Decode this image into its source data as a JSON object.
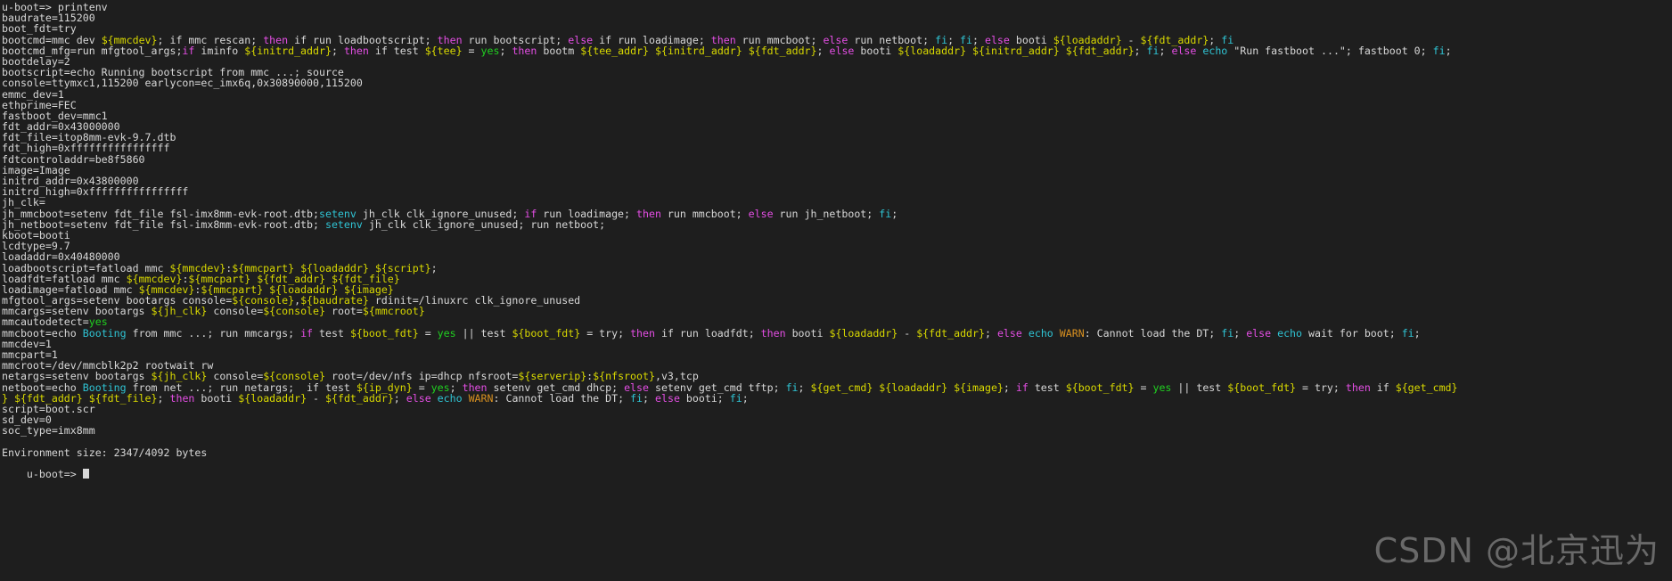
{
  "terminal": {
    "prompt": "u-boot=> ",
    "command": "printenv",
    "background_color": "#1e1e1e",
    "foreground_color": "#d8d8d8",
    "colors": {
      "variable": "#d8d800",
      "keyword": "#e44ee4",
      "builtin": "#2fc4d4",
      "value_yes": "#20d020",
      "warning": "#d89020"
    },
    "footer_status": "Environment size: 2347/4092 bytes",
    "final_prompt": "u-boot=> ",
    "watermark": "CSDN @北京迅为"
  },
  "lines": [
    {
      "id": 0,
      "segments": [
        {
          "t": "u-boot=> printenv",
          "c": "def"
        }
      ]
    },
    {
      "id": 1,
      "segments": [
        {
          "t": "baudrate=115200",
          "c": "def"
        }
      ]
    },
    {
      "id": 2,
      "segments": [
        {
          "t": "boot_fdt=try",
          "c": "def"
        }
      ]
    },
    {
      "id": 3,
      "segments": [
        {
          "t": "bootcmd=mmc dev ",
          "c": "def"
        },
        {
          "t": "${mmcdev}",
          "c": "var"
        },
        {
          "t": "; if mmc rescan; ",
          "c": "def"
        },
        {
          "t": "then",
          "c": "kw"
        },
        {
          "t": " if run loadbootscript; ",
          "c": "def"
        },
        {
          "t": "then",
          "c": "kw"
        },
        {
          "t": " run bootscript; ",
          "c": "def"
        },
        {
          "t": "else",
          "c": "kw"
        },
        {
          "t": " if run loadimage; ",
          "c": "def"
        },
        {
          "t": "then",
          "c": "kw"
        },
        {
          "t": " run mmcboot; ",
          "c": "def"
        },
        {
          "t": "else",
          "c": "kw"
        },
        {
          "t": " run netboot; ",
          "c": "def"
        },
        {
          "t": "fi",
          "c": "fi"
        },
        {
          "t": "; ",
          "c": "def"
        },
        {
          "t": "fi",
          "c": "fi"
        },
        {
          "t": "; ",
          "c": "def"
        },
        {
          "t": "else",
          "c": "kw"
        },
        {
          "t": " booti ",
          "c": "def"
        },
        {
          "t": "${loadaddr}",
          "c": "var"
        },
        {
          "t": " - ",
          "c": "def"
        },
        {
          "t": "${fdt_addr}",
          "c": "var"
        },
        {
          "t": "; ",
          "c": "def"
        },
        {
          "t": "fi",
          "c": "fi"
        }
      ]
    },
    {
      "id": 4,
      "segments": [
        {
          "t": "bootcmd_mfg=run mfgtool_args;",
          "c": "def"
        },
        {
          "t": "if",
          "c": "kw"
        },
        {
          "t": " iminfo ",
          "c": "def"
        },
        {
          "t": "${initrd_addr}",
          "c": "var"
        },
        {
          "t": "; ",
          "c": "def"
        },
        {
          "t": "then",
          "c": "kw"
        },
        {
          "t": " if test ",
          "c": "def"
        },
        {
          "t": "${tee}",
          "c": "var"
        },
        {
          "t": " = ",
          "c": "def"
        },
        {
          "t": "yes",
          "c": "yes"
        },
        {
          "t": "; ",
          "c": "def"
        },
        {
          "t": "then",
          "c": "kw"
        },
        {
          "t": " bootm ",
          "c": "def"
        },
        {
          "t": "${tee_addr}",
          "c": "var"
        },
        {
          "t": " ",
          "c": "def"
        },
        {
          "t": "${initrd_addr}",
          "c": "var"
        },
        {
          "t": " ",
          "c": "def"
        },
        {
          "t": "${fdt_addr}",
          "c": "var"
        },
        {
          "t": "; ",
          "c": "def"
        },
        {
          "t": "else",
          "c": "kw"
        },
        {
          "t": " booti ",
          "c": "def"
        },
        {
          "t": "${loadaddr}",
          "c": "var"
        },
        {
          "t": " ",
          "c": "def"
        },
        {
          "t": "${initrd_addr}",
          "c": "var"
        },
        {
          "t": " ",
          "c": "def"
        },
        {
          "t": "${fdt_addr}",
          "c": "var"
        },
        {
          "t": "; ",
          "c": "def"
        },
        {
          "t": "fi",
          "c": "fi"
        },
        {
          "t": "; ",
          "c": "def"
        },
        {
          "t": "else",
          "c": "kw"
        },
        {
          "t": " ",
          "c": "def"
        },
        {
          "t": "echo",
          "c": "fi"
        },
        {
          "t": " \"Run fastboot ...\"; fastboot 0; ",
          "c": "def"
        },
        {
          "t": "fi",
          "c": "fi"
        },
        {
          "t": ";",
          "c": "def"
        }
      ]
    },
    {
      "id": 5,
      "segments": [
        {
          "t": "bootdelay=2",
          "c": "def"
        }
      ]
    },
    {
      "id": 6,
      "segments": [
        {
          "t": "bootscript=echo Running bootscript from mmc ...; source",
          "c": "def"
        }
      ]
    },
    {
      "id": 7,
      "segments": [
        {
          "t": "console=ttymxc1,115200 earlycon=ec_imx6q,0x30890000,115200",
          "c": "def"
        }
      ]
    },
    {
      "id": 8,
      "segments": [
        {
          "t": "emmc_dev=1",
          "c": "def"
        }
      ]
    },
    {
      "id": 9,
      "segments": [
        {
          "t": "ethprime=FEC",
          "c": "def"
        }
      ]
    },
    {
      "id": 10,
      "segments": [
        {
          "t": "fastboot_dev=mmc1",
          "c": "def"
        }
      ]
    },
    {
      "id": 11,
      "segments": [
        {
          "t": "fdt_addr=0x43000000",
          "c": "def"
        }
      ]
    },
    {
      "id": 12,
      "segments": [
        {
          "t": "fdt_file=itop8mm-evk-9.7.dtb",
          "c": "def"
        }
      ]
    },
    {
      "id": 13,
      "segments": [
        {
          "t": "fdt_high=0xffffffffffffffff",
          "c": "def"
        }
      ]
    },
    {
      "id": 14,
      "segments": [
        {
          "t": "fdtcontroladdr=be8f5860",
          "c": "def"
        }
      ]
    },
    {
      "id": 15,
      "segments": [
        {
          "t": "image=Image",
          "c": "def"
        }
      ]
    },
    {
      "id": 16,
      "segments": [
        {
          "t": "initrd_addr=0x43800000",
          "c": "def"
        }
      ]
    },
    {
      "id": 17,
      "segments": [
        {
          "t": "initrd_high=0xffffffffffffffff",
          "c": "def"
        }
      ]
    },
    {
      "id": 18,
      "segments": [
        {
          "t": "jh_clk=",
          "c": "def"
        }
      ]
    },
    {
      "id": 19,
      "segments": [
        {
          "t": "jh_mmcboot=setenv fdt_file fsl-imx8mm-evk-root.dtb;",
          "c": "def"
        },
        {
          "t": "setenv",
          "c": "fi"
        },
        {
          "t": " jh_clk clk_ignore_unused; ",
          "c": "def"
        },
        {
          "t": "if",
          "c": "kw"
        },
        {
          "t": " run loadimage; ",
          "c": "def"
        },
        {
          "t": "then",
          "c": "kw"
        },
        {
          "t": " run mmcboot; ",
          "c": "def"
        },
        {
          "t": "else",
          "c": "kw"
        },
        {
          "t": " run jh_netboot; ",
          "c": "def"
        },
        {
          "t": "fi",
          "c": "fi"
        },
        {
          "t": ";",
          "c": "def"
        }
      ]
    },
    {
      "id": 20,
      "segments": [
        {
          "t": "jh_netboot=setenv fdt_file fsl-imx8mm-evk-root.dtb; ",
          "c": "def"
        },
        {
          "t": "setenv",
          "c": "fi"
        },
        {
          "t": " jh_clk clk_ignore_unused; run netboot;",
          "c": "def"
        }
      ]
    },
    {
      "id": 21,
      "segments": [
        {
          "t": "kboot=booti",
          "c": "def"
        }
      ]
    },
    {
      "id": 22,
      "segments": [
        {
          "t": "lcdtype=9.7",
          "c": "def"
        }
      ]
    },
    {
      "id": 23,
      "segments": [
        {
          "t": "loadaddr=0x40480000",
          "c": "def"
        }
      ]
    },
    {
      "id": 24,
      "segments": [
        {
          "t": "loadbootscript=fatload mmc ",
          "c": "def"
        },
        {
          "t": "${mmcdev}",
          "c": "var"
        },
        {
          "t": ":",
          "c": "def"
        },
        {
          "t": "${mmcpart}",
          "c": "var"
        },
        {
          "t": " ",
          "c": "def"
        },
        {
          "t": "${loadaddr}",
          "c": "var"
        },
        {
          "t": " ",
          "c": "def"
        },
        {
          "t": "${script}",
          "c": "var"
        },
        {
          "t": ";",
          "c": "def"
        }
      ]
    },
    {
      "id": 25,
      "segments": [
        {
          "t": "loadfdt=fatload mmc ",
          "c": "def"
        },
        {
          "t": "${mmcdev}",
          "c": "var"
        },
        {
          "t": ":",
          "c": "def"
        },
        {
          "t": "${mmcpart}",
          "c": "var"
        },
        {
          "t": " ",
          "c": "def"
        },
        {
          "t": "${fdt_addr}",
          "c": "var"
        },
        {
          "t": " ",
          "c": "def"
        },
        {
          "t": "${fdt_file}",
          "c": "var"
        }
      ]
    },
    {
      "id": 26,
      "segments": [
        {
          "t": "loadimage=fatload mmc ",
          "c": "def"
        },
        {
          "t": "${mmcdev}",
          "c": "var"
        },
        {
          "t": ":",
          "c": "def"
        },
        {
          "t": "${mmcpart}",
          "c": "var"
        },
        {
          "t": " ",
          "c": "def"
        },
        {
          "t": "${loadaddr}",
          "c": "var"
        },
        {
          "t": " ",
          "c": "def"
        },
        {
          "t": "${image}",
          "c": "var"
        }
      ]
    },
    {
      "id": 27,
      "segments": [
        {
          "t": "mfgtool_args=setenv bootargs console=",
          "c": "def"
        },
        {
          "t": "${console}",
          "c": "var"
        },
        {
          "t": ",",
          "c": "def"
        },
        {
          "t": "${baudrate}",
          "c": "var"
        },
        {
          "t": " rdinit=/linuxrc clk_ignore_unused",
          "c": "def"
        }
      ]
    },
    {
      "id": 28,
      "segments": [
        {
          "t": "mmcargs=setenv bootargs ",
          "c": "def"
        },
        {
          "t": "${jh_clk}",
          "c": "var"
        },
        {
          "t": " console=",
          "c": "def"
        },
        {
          "t": "${console}",
          "c": "var"
        },
        {
          "t": " root=",
          "c": "def"
        },
        {
          "t": "${mmcroot}",
          "c": "var"
        }
      ]
    },
    {
      "id": 29,
      "segments": [
        {
          "t": "mmcautodetect=",
          "c": "def"
        },
        {
          "t": "yes",
          "c": "yes"
        }
      ]
    },
    {
      "id": 30,
      "segments": [
        {
          "t": "mmcboot=echo ",
          "c": "def"
        },
        {
          "t": "Booting",
          "c": "fi"
        },
        {
          "t": " from mmc ...; run mmcargs; ",
          "c": "def"
        },
        {
          "t": "if",
          "c": "kw"
        },
        {
          "t": " test ",
          "c": "def"
        },
        {
          "t": "${boot_fdt}",
          "c": "var"
        },
        {
          "t": " = ",
          "c": "def"
        },
        {
          "t": "yes",
          "c": "yes"
        },
        {
          "t": " || test ",
          "c": "def"
        },
        {
          "t": "${boot_fdt}",
          "c": "var"
        },
        {
          "t": " = try; ",
          "c": "def"
        },
        {
          "t": "then",
          "c": "kw"
        },
        {
          "t": " if run loadfdt; ",
          "c": "def"
        },
        {
          "t": "then",
          "c": "kw"
        },
        {
          "t": " booti ",
          "c": "def"
        },
        {
          "t": "${loadaddr}",
          "c": "var"
        },
        {
          "t": " - ",
          "c": "def"
        },
        {
          "t": "${fdt_addr}",
          "c": "var"
        },
        {
          "t": "; ",
          "c": "def"
        },
        {
          "t": "else",
          "c": "kw"
        },
        {
          "t": " ",
          "c": "def"
        },
        {
          "t": "echo",
          "c": "fi"
        },
        {
          "t": " ",
          "c": "def"
        },
        {
          "t": "WARN",
          "c": "warn"
        },
        {
          "t": ": Cannot load the DT; ",
          "c": "def"
        },
        {
          "t": "fi",
          "c": "fi"
        },
        {
          "t": "; ",
          "c": "def"
        },
        {
          "t": "else",
          "c": "kw"
        },
        {
          "t": " ",
          "c": "def"
        },
        {
          "t": "echo",
          "c": "fi"
        },
        {
          "t": " wait for boot; ",
          "c": "def"
        },
        {
          "t": "fi",
          "c": "fi"
        },
        {
          "t": ";",
          "c": "def"
        }
      ]
    },
    {
      "id": 31,
      "segments": [
        {
          "t": "mmcdev=1",
          "c": "def"
        }
      ]
    },
    {
      "id": 32,
      "segments": [
        {
          "t": "mmcpart=1",
          "c": "def"
        }
      ]
    },
    {
      "id": 33,
      "segments": [
        {
          "t": "mmcroot=/dev/mmcblk2p2 rootwait rw",
          "c": "def"
        }
      ]
    },
    {
      "id": 34,
      "segments": [
        {
          "t": "netargs=setenv bootargs ",
          "c": "def"
        },
        {
          "t": "${jh_clk}",
          "c": "var"
        },
        {
          "t": " console=",
          "c": "def"
        },
        {
          "t": "${console}",
          "c": "var"
        },
        {
          "t": " root=/dev/nfs ip=dhcp nfsroot=",
          "c": "def"
        },
        {
          "t": "${serverip}",
          "c": "var"
        },
        {
          "t": ":",
          "c": "def"
        },
        {
          "t": "${nfsroot}",
          "c": "var"
        },
        {
          "t": ",v3,tcp",
          "c": "def"
        }
      ]
    },
    {
      "id": 35,
      "segments": [
        {
          "t": "netboot=echo ",
          "c": "def"
        },
        {
          "t": "Booting",
          "c": "fi"
        },
        {
          "t": " from net ...; run netargs;  if test ",
          "c": "def"
        },
        {
          "t": "${ip_dyn}",
          "c": "var"
        },
        {
          "t": " = ",
          "c": "def"
        },
        {
          "t": "yes",
          "c": "yes"
        },
        {
          "t": "; ",
          "c": "def"
        },
        {
          "t": "then",
          "c": "kw"
        },
        {
          "t": " setenv get_cmd dhcp; ",
          "c": "def"
        },
        {
          "t": "else",
          "c": "kw"
        },
        {
          "t": " setenv get_cmd tftp; ",
          "c": "def"
        },
        {
          "t": "fi",
          "c": "fi"
        },
        {
          "t": "; ",
          "c": "def"
        },
        {
          "t": "${get_cmd}",
          "c": "var"
        },
        {
          "t": " ",
          "c": "def"
        },
        {
          "t": "${loadaddr}",
          "c": "var"
        },
        {
          "t": " ",
          "c": "def"
        },
        {
          "t": "${image}",
          "c": "var"
        },
        {
          "t": "; ",
          "c": "def"
        },
        {
          "t": "if",
          "c": "kw"
        },
        {
          "t": " test ",
          "c": "def"
        },
        {
          "t": "${boot_fdt}",
          "c": "var"
        },
        {
          "t": " = ",
          "c": "def"
        },
        {
          "t": "yes",
          "c": "yes"
        },
        {
          "t": " || test ",
          "c": "def"
        },
        {
          "t": "${boot_fdt}",
          "c": "var"
        },
        {
          "t": " = try; ",
          "c": "def"
        },
        {
          "t": "then",
          "c": "kw"
        },
        {
          "t": " if ",
          "c": "def"
        },
        {
          "t": "${get_cmd}",
          "c": "var"
        }
      ]
    },
    {
      "id": 36,
      "segments": [
        {
          "t": "} ",
          "c": "var"
        },
        {
          "t": "${fdt_addr}",
          "c": "var"
        },
        {
          "t": " ",
          "c": "def"
        },
        {
          "t": "${fdt_file}",
          "c": "var"
        },
        {
          "t": "; ",
          "c": "def"
        },
        {
          "t": "then",
          "c": "kw"
        },
        {
          "t": " booti ",
          "c": "def"
        },
        {
          "t": "${loadaddr}",
          "c": "var"
        },
        {
          "t": " - ",
          "c": "def"
        },
        {
          "t": "${fdt_addr}",
          "c": "var"
        },
        {
          "t": "; ",
          "c": "def"
        },
        {
          "t": "else",
          "c": "kw"
        },
        {
          "t": " ",
          "c": "def"
        },
        {
          "t": "echo",
          "c": "fi"
        },
        {
          "t": " ",
          "c": "def"
        },
        {
          "t": "WARN",
          "c": "warn"
        },
        {
          "t": ": Cannot load the DT; ",
          "c": "def"
        },
        {
          "t": "fi",
          "c": "fi"
        },
        {
          "t": "; ",
          "c": "def"
        },
        {
          "t": "else",
          "c": "kw"
        },
        {
          "t": " booti; ",
          "c": "def"
        },
        {
          "t": "fi",
          "c": "fi"
        },
        {
          "t": ";",
          "c": "def"
        }
      ]
    },
    {
      "id": 37,
      "segments": [
        {
          "t": "script=boot.scr",
          "c": "def"
        }
      ]
    },
    {
      "id": 38,
      "segments": [
        {
          "t": "sd_dev=0",
          "c": "def"
        }
      ]
    },
    {
      "id": 39,
      "segments": [
        {
          "t": "soc_type=imx8mm",
          "c": "def"
        }
      ]
    },
    {
      "id": 40,
      "segments": []
    },
    {
      "id": 41,
      "segments": [
        {
          "t": "Environment size: 2347/4092 bytes",
          "c": "def"
        }
      ]
    }
  ]
}
